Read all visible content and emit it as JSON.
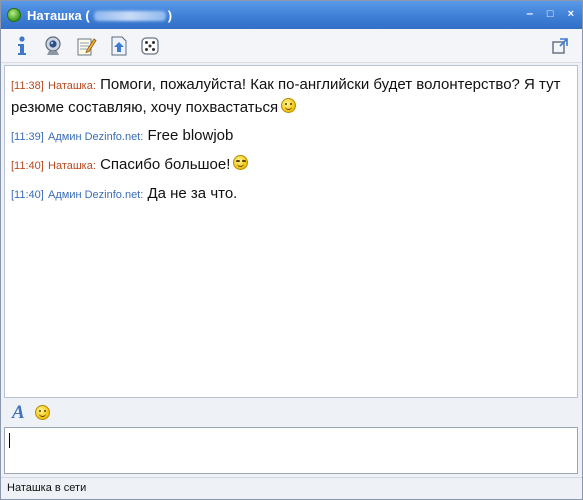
{
  "window": {
    "title_name": "Наташка",
    "title_open": "(",
    "title_close": ")",
    "controls": [
      "‒",
      "□",
      "×"
    ]
  },
  "toolbar": {
    "icons": [
      "info-icon",
      "webcam-icon",
      "notes-icon",
      "send-file-icon",
      "dice-icon"
    ],
    "detach_icon": "detach-window-icon"
  },
  "messages": [
    {
      "time": "[11:38]",
      "sender": "Наташка:",
      "sender_type": "contact",
      "text": "Помоги, пожалуйста! Как по-английски будет волонтерство? Я тут резюме составляю, хочу похвастаться",
      "emoji": "smile"
    },
    {
      "time": "[11:39]",
      "sender": "Админ Dezinfo.net:",
      "sender_type": "self",
      "text": "Free blowjob",
      "emoji": ""
    },
    {
      "time": "[11:40]",
      "sender": "Наташка:",
      "sender_type": "contact",
      "text": "Спасибо большое!",
      "emoji": "wink"
    },
    {
      "time": "[11:40]",
      "sender": "Админ Dezinfo.net:",
      "sender_type": "self",
      "text": "Да не за что.",
      "emoji": ""
    }
  ],
  "format_bar": {
    "font_label": "A",
    "emoji_icon": "smiley-icon"
  },
  "input": {
    "value": ""
  },
  "status": {
    "text": "Наташка в сети"
  },
  "colors": {
    "titlebar": "#3f7fd6",
    "contact_meta": "#b9491f",
    "self_meta": "#3a6db5"
  }
}
